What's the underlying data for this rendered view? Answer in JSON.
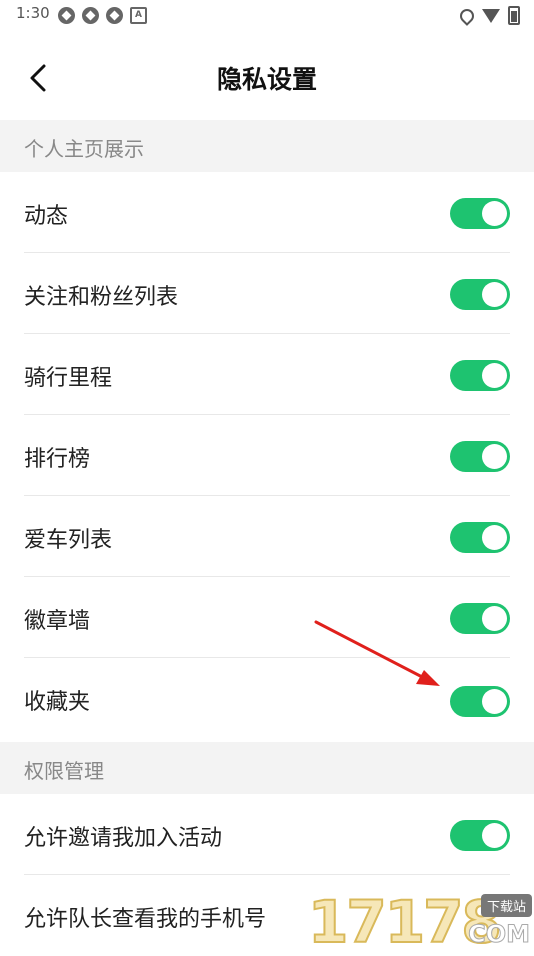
{
  "status_bar": {
    "time": "1:30"
  },
  "header": {
    "title": "隐私设置"
  },
  "sections": [
    {
      "title": "个人主页展示",
      "items": [
        {
          "label": "动态",
          "on": true
        },
        {
          "label": "关注和粉丝列表",
          "on": true
        },
        {
          "label": "骑行里程",
          "on": true
        },
        {
          "label": "排行榜",
          "on": true
        },
        {
          "label": "爱车列表",
          "on": true
        },
        {
          "label": "徽章墙",
          "on": true
        },
        {
          "label": "收藏夹",
          "on": true
        }
      ]
    },
    {
      "title": "权限管理",
      "items": [
        {
          "label": "允许邀请我加入活动",
          "on": true
        },
        {
          "label": "允许队长查看我的手机号",
          "on": false
        }
      ]
    }
  ],
  "colors": {
    "toggle_on": "#1ec370",
    "arrow": "#e0201c",
    "section_bg": "#f3f3f3"
  },
  "watermark": {
    "digits": "17178",
    "tag": "下载站",
    "suffix": "COM"
  }
}
